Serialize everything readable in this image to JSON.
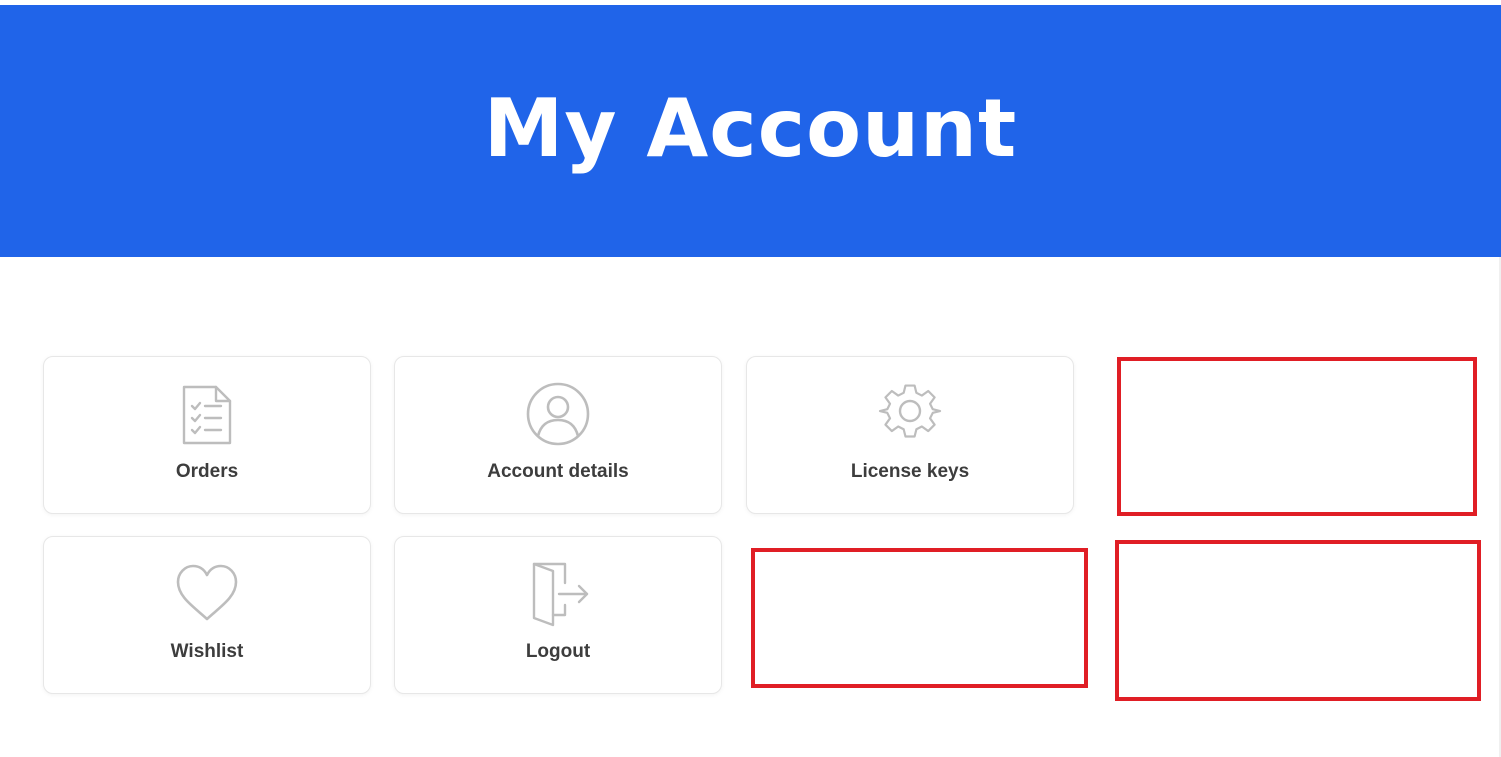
{
  "header": {
    "title": "My Account",
    "background_color": "#2064e9"
  },
  "dashboard": {
    "cards": [
      {
        "label": "Orders",
        "icon": "clipboard-list-icon"
      },
      {
        "label": "Account details",
        "icon": "user-circle-icon"
      },
      {
        "label": "License keys",
        "icon": "gear-icon"
      },
      {
        "label": "Wishlist",
        "icon": "heart-icon"
      },
      {
        "label": "Logout",
        "icon": "door-exit-icon"
      }
    ],
    "highlight_color": "#e01e25"
  }
}
